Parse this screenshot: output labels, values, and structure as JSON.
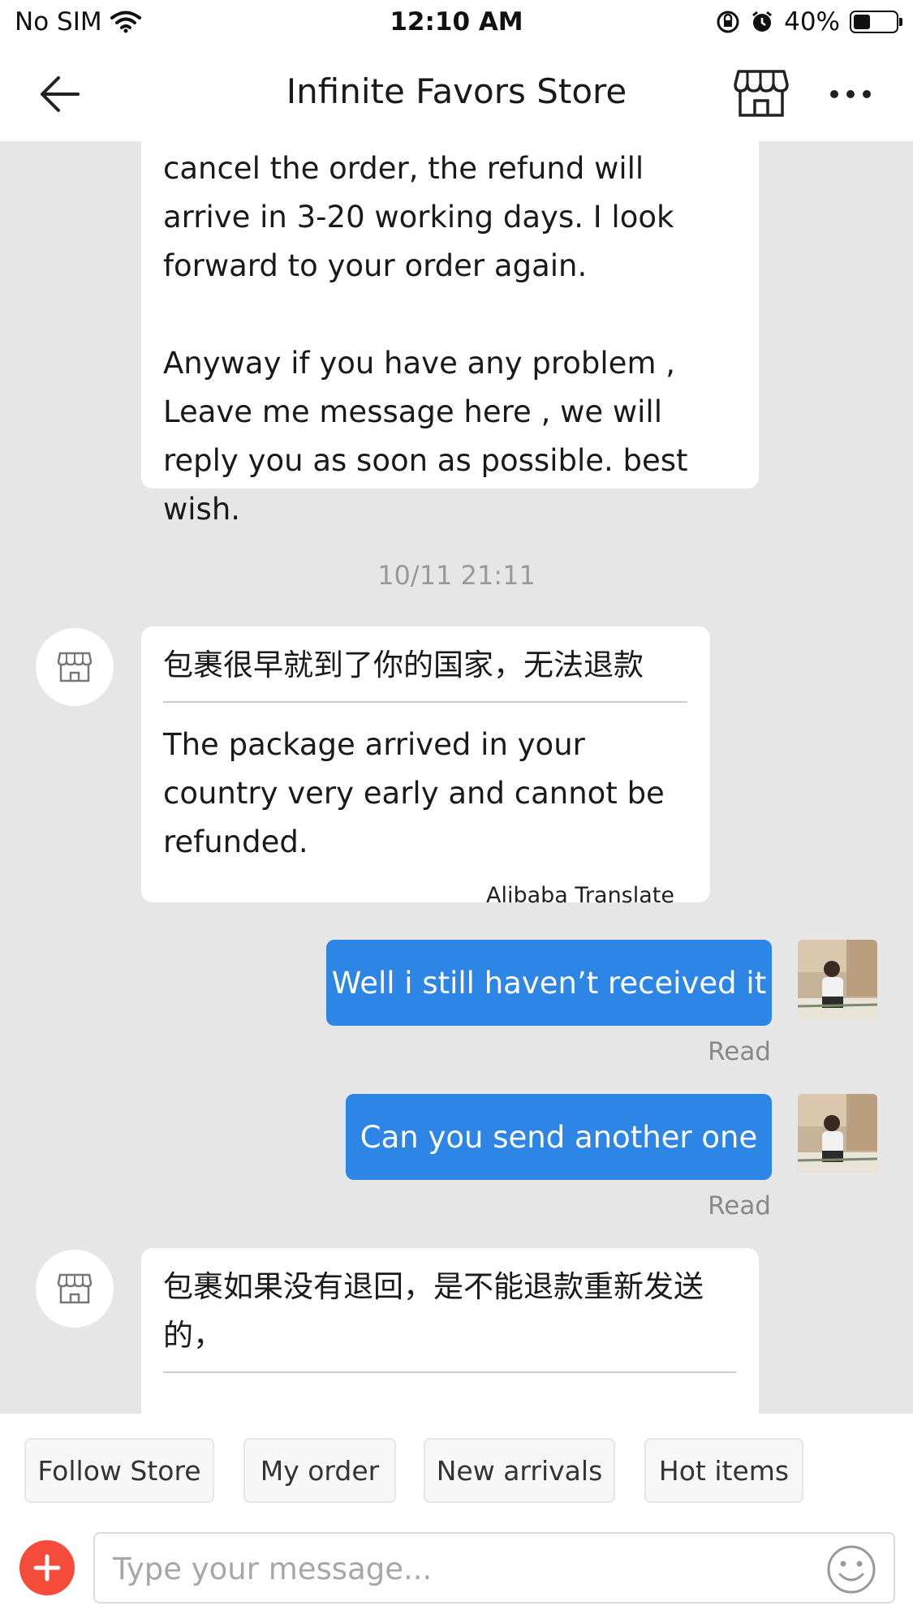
{
  "status_bar": {
    "carrier": "No SIM",
    "time": "12:10 AM",
    "battery_percent": "40%",
    "battery_level": 0.4
  },
  "header": {
    "title": "Infinite Favors Store",
    "icons": [
      "back-arrow-icon",
      "store-icon",
      "more-icon"
    ]
  },
  "messages": {
    "top_partial": "cancel the order, the refund will arrive in 3-20 working days. I look forward to your order again.\n\nAnyway if you have any problem , Leave me message here , we will reply you as soon as possible. best wish.",
    "timestamp": "10/11 21:11",
    "store_msg1": {
      "original": "包裹很早就到了你的国家，无法退款",
      "translation": "The package arrived in your country very early and cannot be refunded.",
      "translate_label": "Alibaba Translate"
    },
    "user_msg1": {
      "text": "Well i still haven’t received it",
      "status": "Read"
    },
    "user_msg2": {
      "text": "Can you send another one",
      "status": "Read"
    },
    "store_msg2": {
      "original": "包裹如果没有退回，是不能退款重新发送的，"
    }
  },
  "quick_actions": [
    "Follow Store",
    "My order",
    "New arrivals",
    "Hot items"
  ],
  "composer": {
    "placeholder": "Type your message...",
    "icons": [
      "plus-icon",
      "emoji-icon"
    ]
  },
  "colors": {
    "outgoing_bubble": "#2d86e6",
    "plus_button": "#f44b3a",
    "chat_background": "#e6e6e6"
  }
}
